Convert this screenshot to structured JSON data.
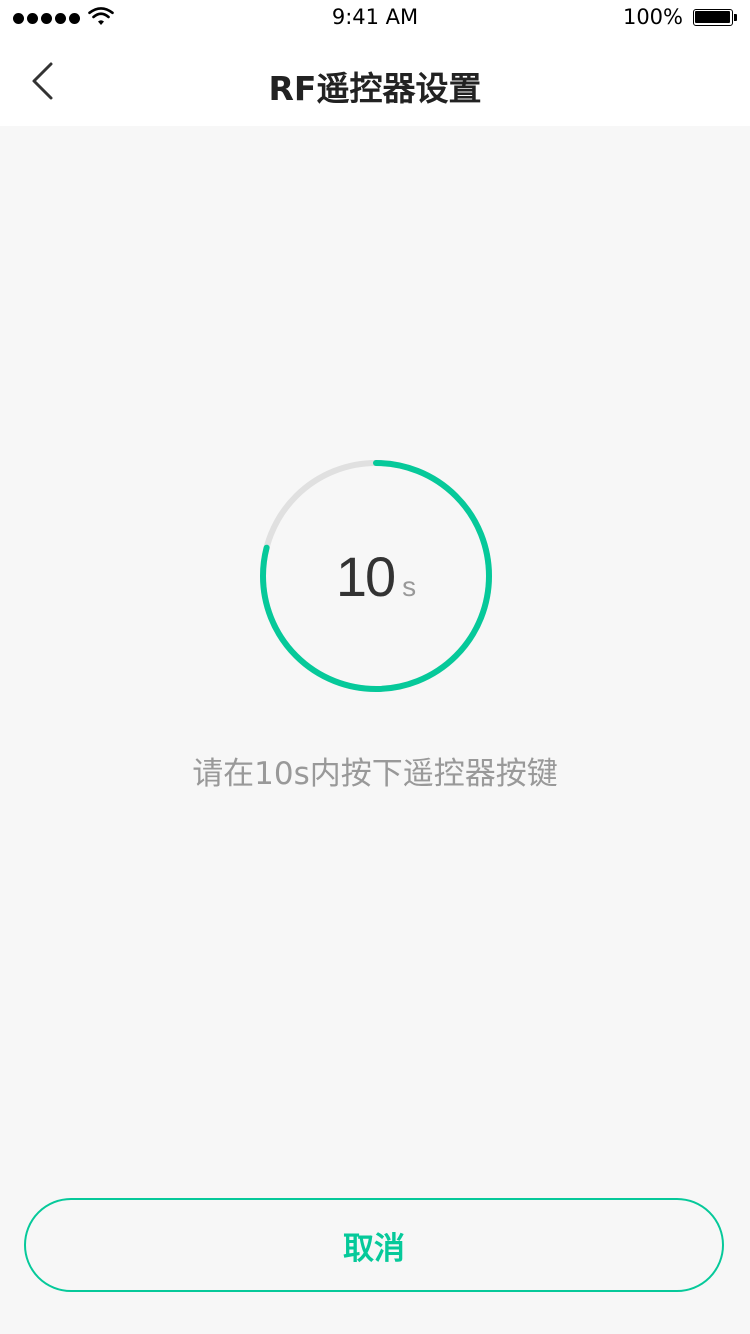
{
  "status_bar": {
    "time": "9:41 AM",
    "battery_percent": "100%",
    "icons": [
      "signal-dots-icon",
      "wifi-icon",
      "battery-icon"
    ]
  },
  "header": {
    "title": "RF遥控器设置",
    "back_icon": "chevron-left-icon"
  },
  "countdown": {
    "value": "10",
    "unit": "s",
    "progress_fraction": 0.79,
    "progress_color": "#06c99a",
    "track_color": "#e0e0e0"
  },
  "instruction": "请在10s内按下遥控器按键",
  "footer": {
    "cancel_label": "取消"
  },
  "colors": {
    "accent": "#06c99a",
    "background": "#f7f7f7"
  }
}
